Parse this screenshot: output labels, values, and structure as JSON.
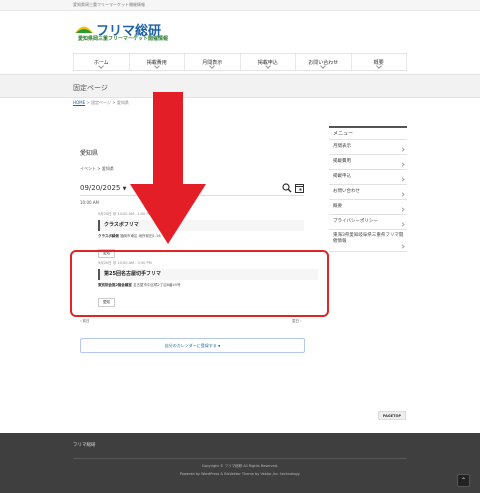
{
  "topbar": {
    "tagline": "愛知県岡三重フリーマーケット開催情報"
  },
  "logo": {
    "main": "フリマ総研",
    "sub": "愛知県岡三重フリーマーケット開催情報"
  },
  "nav": {
    "items": [
      "ホーム",
      "掲載費用",
      "月間表示",
      "掲載申込",
      "お問い合わせ",
      "概要"
    ]
  },
  "page_header": {
    "title": "固定ページ"
  },
  "breadcrumb": {
    "home": "HOME",
    "sep": ">",
    "current": "固定ページ >  愛知県"
  },
  "content": {
    "title": "愛知県",
    "crumb": "イベント > 愛知県",
    "date_picker": "09/20/2025",
    "time_label": "10:00 AM"
  },
  "events": [
    {
      "time": "9月20日 @ 10:00 AM - 1:00 PM",
      "title": "クラスボフリマ",
      "venue_label": "クラスボ縁側",
      "venue_detail": "福岡市東区 地所前田1-16",
      "tag": "愛知"
    },
    {
      "time": "9月20日 @ 10:00 AM - 3:30 PM",
      "title": "第25回名古屋切手フリマ",
      "venue_label": "東別院会館2階会議室",
      "venue_detail": "名古屋市中区橘2丁目8番45号",
      "tag": "愛知"
    }
  ],
  "pager": {
    "prev": "前日",
    "next": "翌日"
  },
  "subscribe": {
    "label": "自分のカレンダーに登録する"
  },
  "sidebar": {
    "heading": "メニュー",
    "items": [
      "月間表示",
      "掲載費用",
      "掲載申込",
      "お問い合わせ",
      "概要",
      "プライバシーポリシー",
      "東海3県愛知岐阜県三重県フリマ開催情報"
    ]
  },
  "pagetop": {
    "label": "PAGETOP"
  },
  "footer": {
    "site": "フリマ総研",
    "copyright": "Copyright © フリマ総研 All Rights Reserved.",
    "powered": "Powered by WordPress & BizVektor Theme by Vektor,Inc. technology."
  },
  "colors": {
    "accent": "#1c62a8",
    "highlight": "#e32424",
    "arrow": "#e41e26"
  },
  "icons": {
    "search": "search-icon",
    "calendar": "calendar-icon",
    "arrow": "down-arrow-icon",
    "to_top": "chevron-up-icon"
  }
}
